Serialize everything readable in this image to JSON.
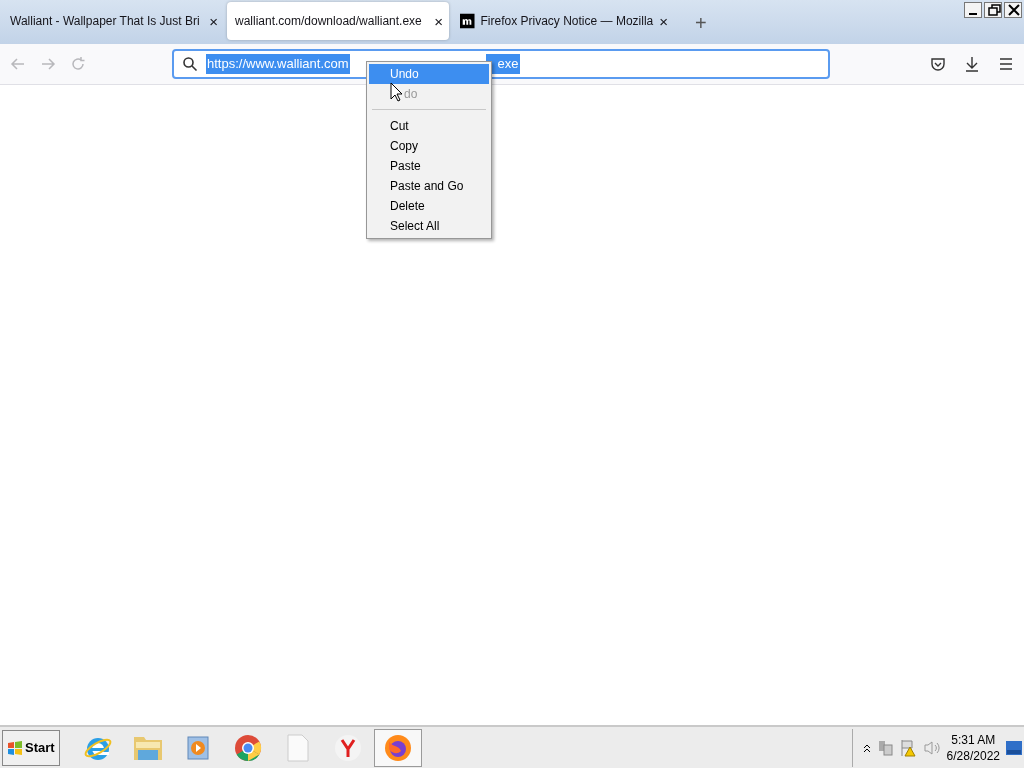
{
  "tabs": [
    {
      "title": "Walliant - Wallpaper That Is Just Bri",
      "selected": false,
      "close": "×"
    },
    {
      "title": "walliant.com/download/walliant.exe",
      "selected": true,
      "close": "×"
    },
    {
      "title": "Firefox Privacy Notice — Mozilla",
      "selected": false,
      "close": "×",
      "kind": "mozilla"
    }
  ],
  "new_tab": "+",
  "address_bar": {
    "url_start": "https://www.walliant.com",
    "url_end": "exe"
  },
  "context_menu": {
    "items": [
      {
        "label": "Undo",
        "selected": true,
        "disabled": false
      },
      {
        "label": "do",
        "selected": false,
        "disabled": true,
        "kind": "covered"
      },
      {
        "kind": "separator"
      },
      {
        "label": "Cut",
        "selected": false,
        "disabled": false
      },
      {
        "label": "Copy",
        "selected": false,
        "disabled": false
      },
      {
        "label": "Paste",
        "selected": false,
        "disabled": false
      },
      {
        "label": "Paste and Go",
        "selected": false,
        "disabled": false
      },
      {
        "label": "Delete",
        "selected": false,
        "disabled": false
      },
      {
        "label": "Select All",
        "selected": false,
        "disabled": false
      }
    ]
  },
  "taskbar": {
    "start": "Start",
    "apps": [
      {
        "kind": "ie",
        "selected": false
      },
      {
        "kind": "folder",
        "selected": false
      },
      {
        "kind": "media",
        "selected": false
      },
      {
        "kind": "chrome",
        "selected": false
      },
      {
        "kind": "file",
        "selected": false
      },
      {
        "kind": "yandex",
        "selected": false
      },
      {
        "kind": "firefox",
        "selected": true
      }
    ],
    "time": "5:31 AM",
    "date": "6/28/2022"
  }
}
